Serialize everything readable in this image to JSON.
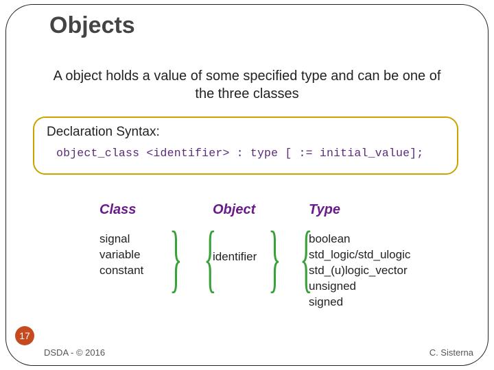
{
  "title": "Objects",
  "subtitle": "A object holds a value of some specified type and can be one of the three classes",
  "syntax": {
    "label": "Declaration Syntax:",
    "code": "object_class <identifier> : type [ := initial_value];"
  },
  "columns": {
    "class": {
      "heading": "Class",
      "items": [
        "signal",
        "variable",
        "constant"
      ]
    },
    "object": {
      "heading": "Object",
      "items": [
        "identifier"
      ]
    },
    "type": {
      "heading": "Type",
      "items": [
        "boolean",
        "std_logic/std_ulogic",
        "std_(u)logic_vector",
        "unsigned",
        "signed"
      ]
    }
  },
  "page_number": "17",
  "footer": {
    "left": "DSDA - © 2016",
    "right": "C. Sisterna"
  }
}
